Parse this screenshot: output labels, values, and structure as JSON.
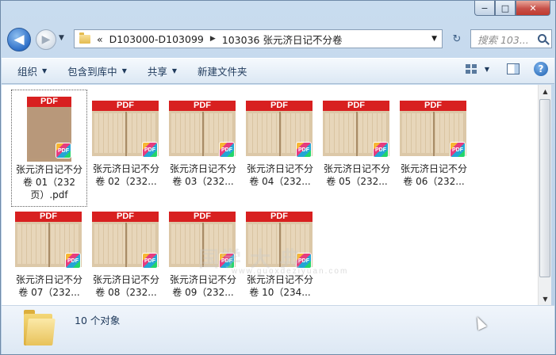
{
  "window": {
    "minimize": "−",
    "maximize": "□",
    "close": "✕"
  },
  "nav": {
    "back": "◀",
    "forward": "▶",
    "history_dropdown": "▼"
  },
  "address": {
    "overflow": "«",
    "items": [
      "D103000-D103099",
      "103036 张元济日记不分卷"
    ],
    "separator": "▶",
    "dropdown": "▼",
    "refresh": "↻"
  },
  "search": {
    "placeholder": "搜索 103..."
  },
  "toolbar": {
    "organize": "组织",
    "include_library": "包含到库中",
    "share": "共享",
    "new_folder": "新建文件夹",
    "help": "?"
  },
  "files": [
    {
      "line1": "张元济日记不分",
      "line2": "卷 01（232",
      "line3": "页）.pdf",
      "selected": true
    },
    {
      "line1": "张元济日记不分",
      "line2": "卷 02（232...",
      "line3": "",
      "selected": false
    },
    {
      "line1": "张元济日记不分",
      "line2": "卷 03（232...",
      "line3": "",
      "selected": false
    },
    {
      "line1": "张元济日记不分",
      "line2": "卷 04（232...",
      "line3": "",
      "selected": false
    },
    {
      "line1": "张元济日记不分",
      "line2": "卷 05（232...",
      "line3": "",
      "selected": false
    },
    {
      "line1": "张元济日记不分",
      "line2": "卷 06（232...",
      "line3": "",
      "selected": false
    },
    {
      "line1": "张元济日记不分",
      "line2": "卷 07（232...",
      "line3": "",
      "selected": false
    },
    {
      "line1": "张元济日记不分",
      "line2": "卷 08（232...",
      "line3": "",
      "selected": false
    },
    {
      "line1": "张元济日记不分",
      "line2": "卷 09（232...",
      "line3": "",
      "selected": false
    },
    {
      "line1": "张元济日记不分",
      "line2": "卷 10（234...",
      "line3": "",
      "selected": false
    }
  ],
  "thumbnail": {
    "band_label": "PDF",
    "badge_label": "PDF"
  },
  "watermark": {
    "main": "国学 大 典",
    "url": "www.guoxdeziyuan.com"
  },
  "status": {
    "count": "10 个对象"
  },
  "colors": {
    "pdf_band": "#d82020",
    "toolbar_text": "#1e395b",
    "selection_border": "#5f5f5f"
  }
}
